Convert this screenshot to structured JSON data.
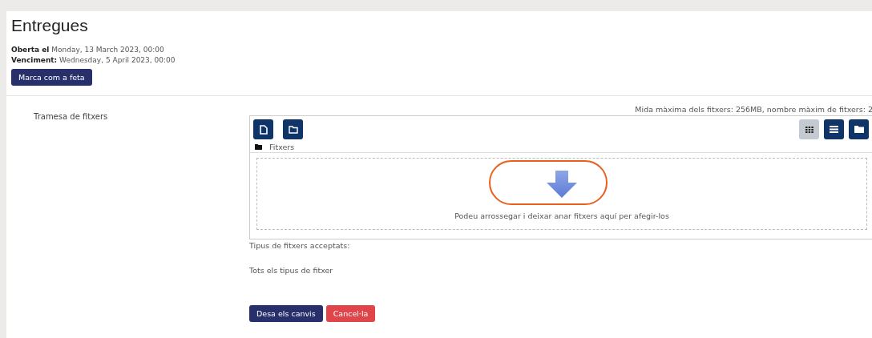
{
  "title": "Entregues",
  "dates": [
    {
      "label": "Oberta el",
      "value": "Monday, 13 March 2023, 00:00"
    },
    {
      "label": "Venciment:",
      "value": "Wednesday, 5 April 2023, 00:00"
    }
  ],
  "mark_done_button": "Marca com a feta",
  "field_label": "Tramesa de fitxers",
  "limits": "Mida màxima dels fitxers: 256MB, nombre màxim de fitxers: 2",
  "view_buttons": [
    {
      "kind": "grid",
      "selected": true
    },
    {
      "kind": "list",
      "selected": false
    },
    {
      "kind": "tree",
      "selected": false
    }
  ],
  "path": "Fitxers",
  "drop_zone": {
    "text": "Podeu arrossegar i deixar anar fitxers aquí per afegir-los",
    "highlighted": true
  },
  "accepted_label": "Tipus de fitxers acceptats:",
  "accepted_value": "Tots els tipus de fitxer",
  "buttons": [
    {
      "kind": "primary",
      "label": "Desa els canvis"
    },
    {
      "kind": "danger",
      "label": "Cancel·la"
    }
  ]
}
